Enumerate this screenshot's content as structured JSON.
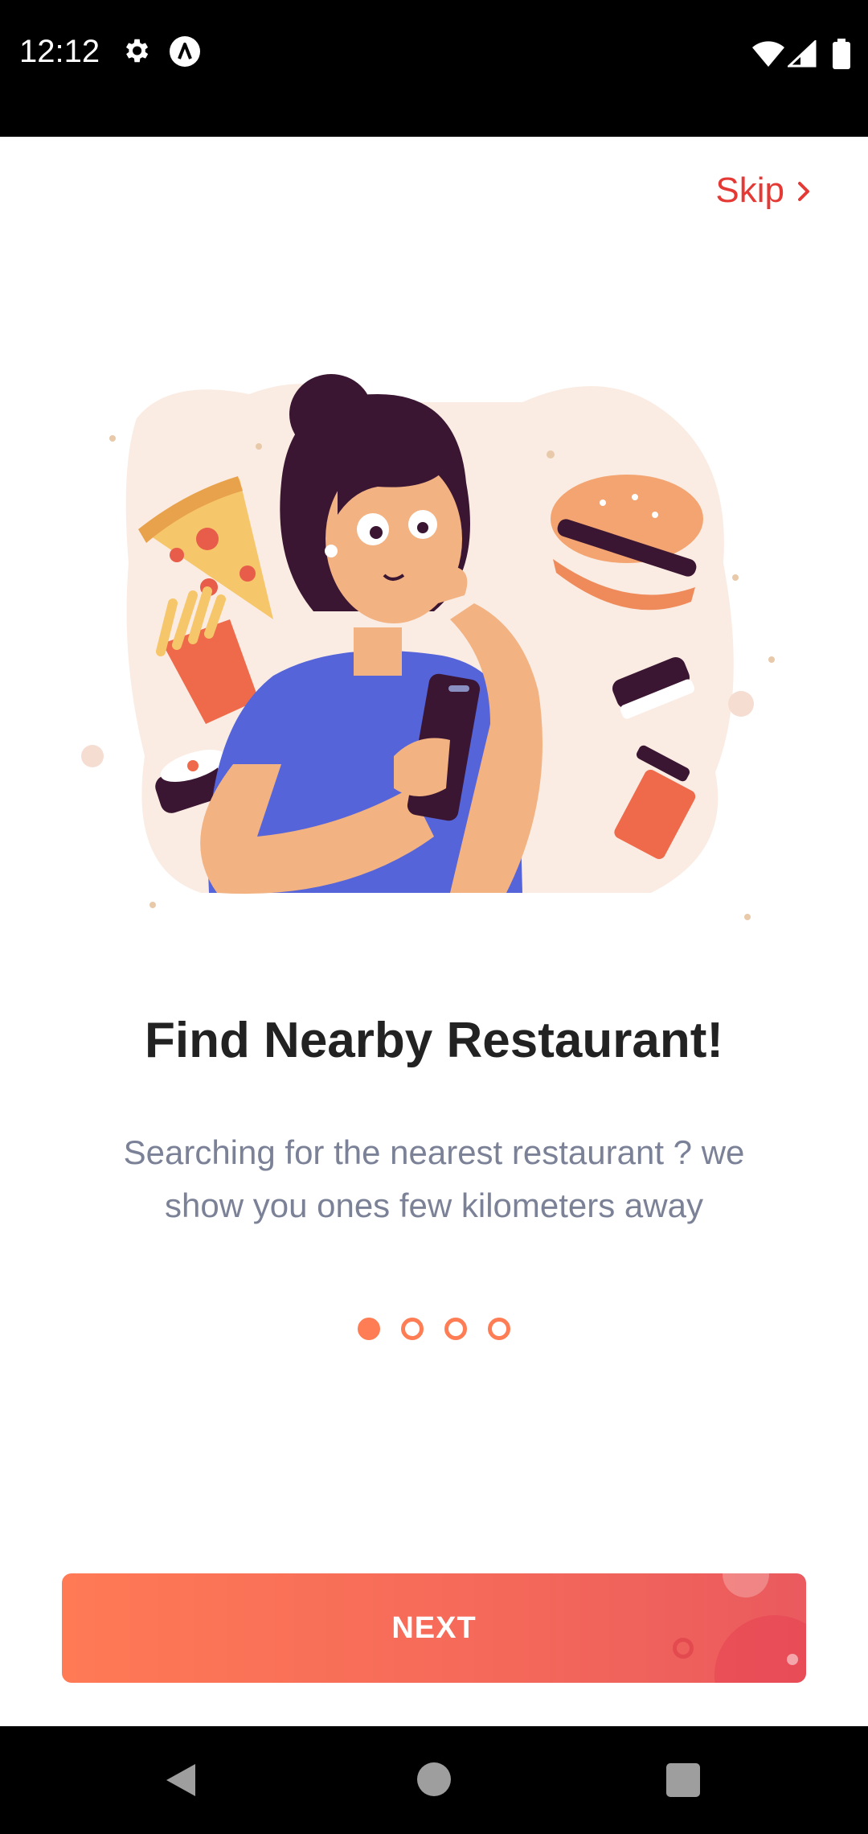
{
  "status_bar": {
    "time": "12:12",
    "icons": [
      "gear-icon",
      "app-logo-icon",
      "wifi-icon",
      "signal-icon",
      "battery-icon"
    ]
  },
  "onboarding": {
    "skip_label": "Skip",
    "title": "Find Nearby Restaurant!",
    "subtitle": "Searching for the nearest restaurant ? we show you ones few kilometers away",
    "page_indicator": {
      "total": 4,
      "current": 1
    },
    "next_label": "NEXT"
  },
  "colors": {
    "accent": "#ff7d55",
    "skip": "#e53935",
    "title": "#222222",
    "subtitle": "#7b8196",
    "button_start": "#ff7a55",
    "button_end": "#ea5a5e"
  },
  "nav_bar": {
    "icons": [
      "back-icon",
      "home-icon",
      "recents-icon"
    ]
  }
}
